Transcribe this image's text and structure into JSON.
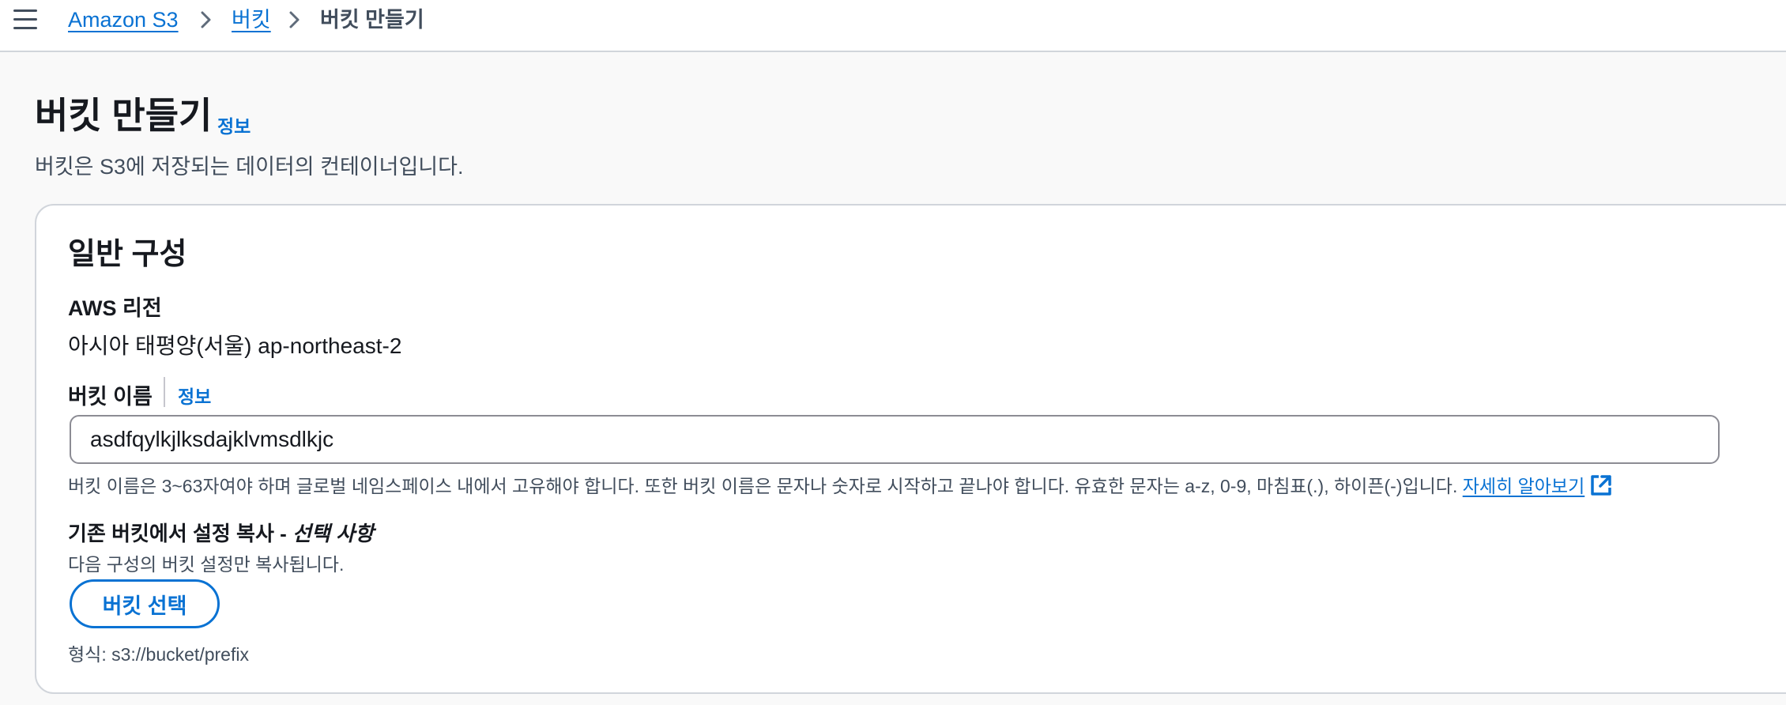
{
  "breadcrumb": {
    "items": [
      {
        "label": "Amazon S3"
      },
      {
        "label": "버킷"
      },
      {
        "label": "버킷 만들기"
      }
    ]
  },
  "header": {
    "title": "버킷 만들기",
    "info_label": "정보",
    "description": "버킷은 S3에 저장되는 데이터의 컨테이너입니다."
  },
  "general": {
    "title": "일반 구성",
    "region_label": "AWS 리전",
    "region_value": "아시아 태평양(서울) ap-northeast-2",
    "bucket_name_label": "버킷 이름",
    "bucket_name_info": "정보",
    "bucket_name_value": "asdfqylkjlksdajklvmsdlkjc",
    "bucket_name_hint": "버킷 이름은 3~63자여야 하며 글로벌 네임스페이스 내에서 고유해야 합니다. 또한 버킷 이름은 문자나 숫자로 시작하고 끝나야 합니다. 유효한 문자는 a-z, 0-9, 마침표(.), 하이픈(-)입니다.",
    "learn_more": "자세히 알아보기",
    "copy_title": "기존 버킷에서 설정 복사 -",
    "copy_optional": "선택 사항",
    "copy_description": "다음 구성의 버킷 설정만 복사됩니다.",
    "choose_bucket_button": "버킷 선택",
    "format_hint": "형식: s3://bucket/prefix"
  },
  "colors": {
    "link": "#0972d3",
    "text": "#16191f",
    "secondary_text": "#414d5c",
    "border": "#d1d5db"
  },
  "icons": [
    "menu-icon",
    "chevron-right-icon",
    "external-link-icon"
  ]
}
